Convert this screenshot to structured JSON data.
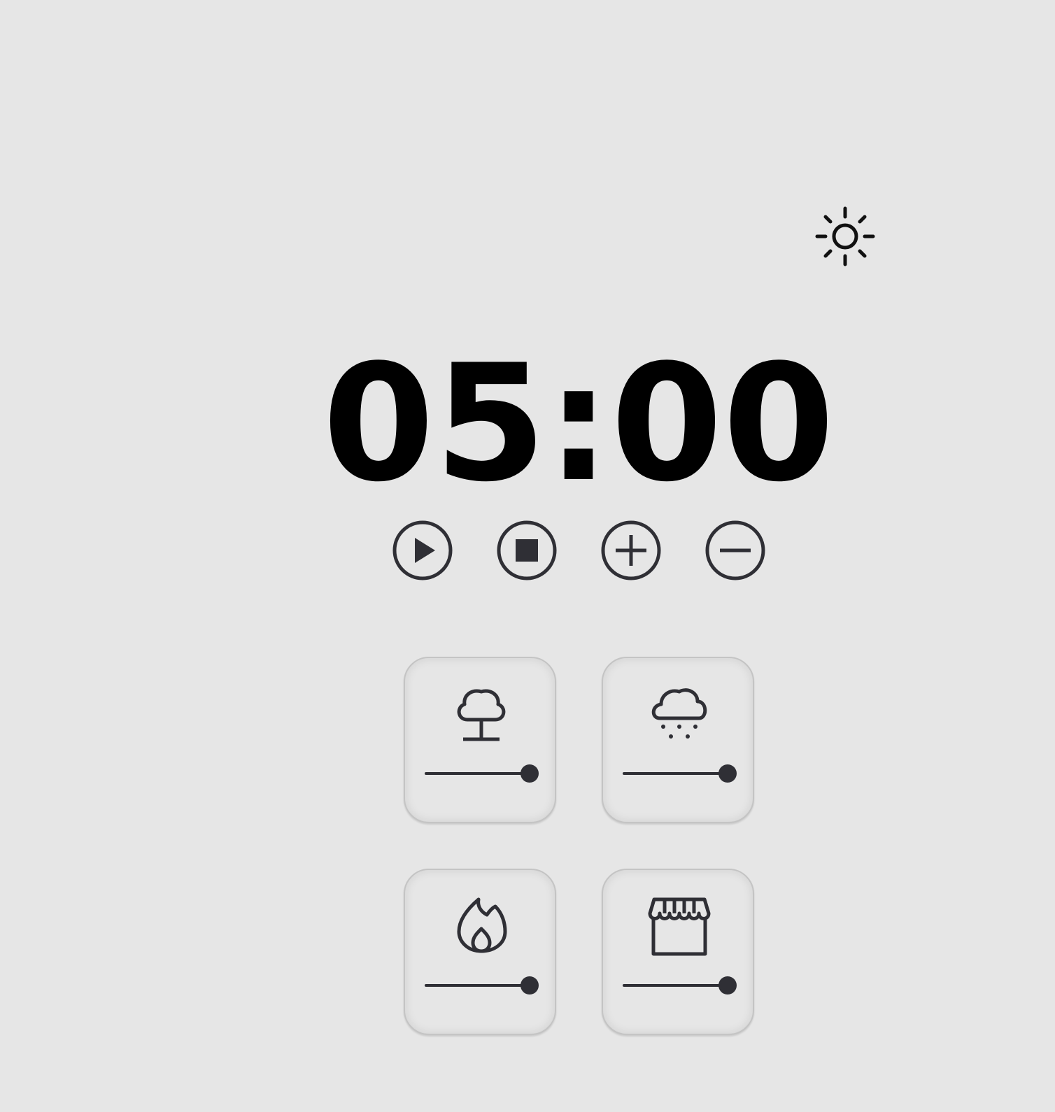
{
  "header": {
    "theme_toggle_icon": "sun-icon"
  },
  "timer": {
    "display": "05:00"
  },
  "controls": [
    {
      "name": "play-button",
      "icon": "play-icon"
    },
    {
      "name": "stop-button",
      "icon": "stop-icon"
    },
    {
      "name": "increase-time-button",
      "icon": "plus-icon"
    },
    {
      "name": "decrease-time-button",
      "icon": "minus-icon"
    }
  ],
  "sounds": [
    {
      "name": "forest",
      "icon": "tree-icon",
      "volume": 1.0
    },
    {
      "name": "rain",
      "icon": "rain-cloud-icon",
      "volume": 1.0
    },
    {
      "name": "fireplace",
      "icon": "flame-icon",
      "volume": 1.0
    },
    {
      "name": "coffee-shop",
      "icon": "storefront-icon",
      "volume": 1.0
    }
  ],
  "colors": {
    "background": "#e6e6e6",
    "icon": "#2f2f35",
    "timer_text": "#000000"
  }
}
